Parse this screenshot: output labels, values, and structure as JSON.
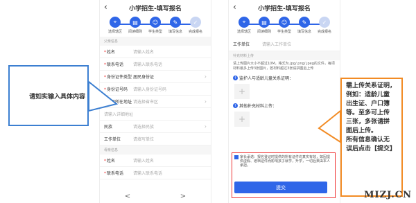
{
  "screen1": {
    "title": "小学招生-填写报名",
    "back": "‹",
    "steps": [
      "选择辖区",
      "阅读细则",
      "学生类型",
      "填写信息",
      "完成报名"
    ],
    "section_father": "父亲信息",
    "rows": [
      {
        "label": "姓名",
        "value": "请输入姓名",
        "req": true
      },
      {
        "label": "联系电话",
        "value": "请输入联系电话",
        "req": true
      },
      {
        "label": "身份证件类型",
        "value": "居民身份证",
        "req": true,
        "dark": true,
        "chev": true
      },
      {
        "label": "身份证号码",
        "value": "请输入身份证号码",
        "req": true
      },
      {
        "label": "户口所在地址",
        "value": "请选择省市区",
        "req": true,
        "chev": true
      }
    ],
    "detail_addr": "请输入详细地址",
    "rows2": [
      {
        "label": "民族",
        "value": "请选择民族",
        "chev": true
      },
      {
        "label": "工作单位",
        "value": "请填写单位"
      }
    ],
    "section_mother": "母亲信息",
    "rows3": [
      {
        "label": "姓名",
        "value": "请输入姓名",
        "req": true
      },
      {
        "label": "联系电话",
        "value": "请输入联系电话",
        "req": true
      }
    ],
    "prev": "<",
    "next": ">"
  },
  "screen2": {
    "title": "小学招生-填写报名",
    "back": "‹",
    "steps": [
      "选择辖区",
      "阅读细则",
      "学生类型",
      "填写信息",
      "完成报名"
    ],
    "work_label": "工作单位",
    "work_value": "请输入工作单位",
    "section_upload": "补充材料上传",
    "note": "请上传图片大小不超过10M，格式为.jpg/.png/.jpeg的文件，每项材料最多上传3张图片，若材料超过3张请拼图后上传",
    "upload1": "监护人与适龄儿童关系证明：",
    "upload2": "其他补充材料上传：",
    "promise": "家长承诺：报名登记时提供的所有证件均真实有效，如因提供虚假、遮档证件而影响孩子就学，升学，一切后果由本人承担。",
    "submit": "提交"
  },
  "callout_left": "请如实输入具体内容",
  "callout_right": [
    "需上传关系证明，",
    "例如：适龄儿童",
    "出生证、户口簿",
    "等。至多可上传",
    "三张，多张请拼",
    "图后上传。",
    "所有信息确认无",
    "误后点击【提交】"
  ],
  "watermark": "MIZJ.CN"
}
